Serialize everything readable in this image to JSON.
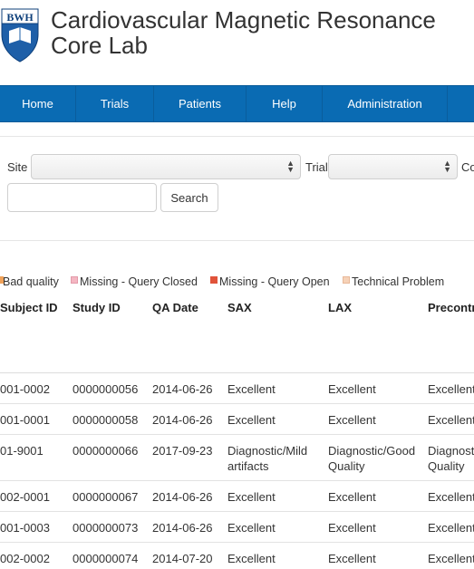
{
  "header": {
    "logo_text": "BWH",
    "title_line1": "Cardiovascular Magnetic Resonance",
    "title_line2": "Core Lab"
  },
  "nav": {
    "items": [
      "Home",
      "Trials",
      "Patients",
      "Help",
      "Administration"
    ]
  },
  "filters": {
    "site_label": "Site",
    "site_value": "",
    "trial_label": "Trial",
    "trial_value": "",
    "cut_label": "Co",
    "search_value": "",
    "search_button": "Search"
  },
  "legend": {
    "items": [
      {
        "label": "Bad quality",
        "color": "#f0a25a"
      },
      {
        "label": "Missing - Query Closed",
        "color": "#f4b6c2"
      },
      {
        "label": "Missing - Query Open",
        "color": "#e0533a"
      },
      {
        "label": "Technical Problem",
        "color": "#f6d2b8"
      }
    ]
  },
  "table": {
    "columns": [
      "Subject ID",
      "Study ID",
      "QA Date",
      "SAX",
      "LAX",
      "Precontr"
    ],
    "rows": [
      {
        "subject": "001-0002",
        "study": "0000000056",
        "date": "2014-06-26",
        "sax": [
          "Excellent"
        ],
        "lax": [
          "Excellent"
        ],
        "pre": [
          "Excellent"
        ]
      },
      {
        "subject": "001-0001",
        "study": "0000000058",
        "date": "2014-06-26",
        "sax": [
          "Excellent"
        ],
        "lax": [
          "Excellent"
        ],
        "pre": [
          "Excellent"
        ]
      },
      {
        "subject": "01-9001",
        "study": "0000000066",
        "date": "2017-09-23",
        "sax": [
          "Diagnostic/Mild",
          "artifacts"
        ],
        "lax": [
          "Diagnostic/Good",
          "Quality"
        ],
        "pre": [
          "Diagnost",
          "Quality"
        ]
      },
      {
        "subject": "002-0001",
        "study": "0000000067",
        "date": "2014-06-26",
        "sax": [
          "Excellent"
        ],
        "lax": [
          "Excellent"
        ],
        "pre": [
          "Excellent"
        ]
      },
      {
        "subject": "001-0003",
        "study": "0000000073",
        "date": "2014-06-26",
        "sax": [
          "Excellent"
        ],
        "lax": [
          "Excellent"
        ],
        "pre": [
          "Excellent"
        ]
      },
      {
        "subject": "002-0002",
        "study": "0000000074",
        "date": "2014-07-20",
        "sax": [
          "Excellent"
        ],
        "lax": [
          "Excellent"
        ],
        "pre": [
          "Excellent"
        ]
      }
    ]
  }
}
